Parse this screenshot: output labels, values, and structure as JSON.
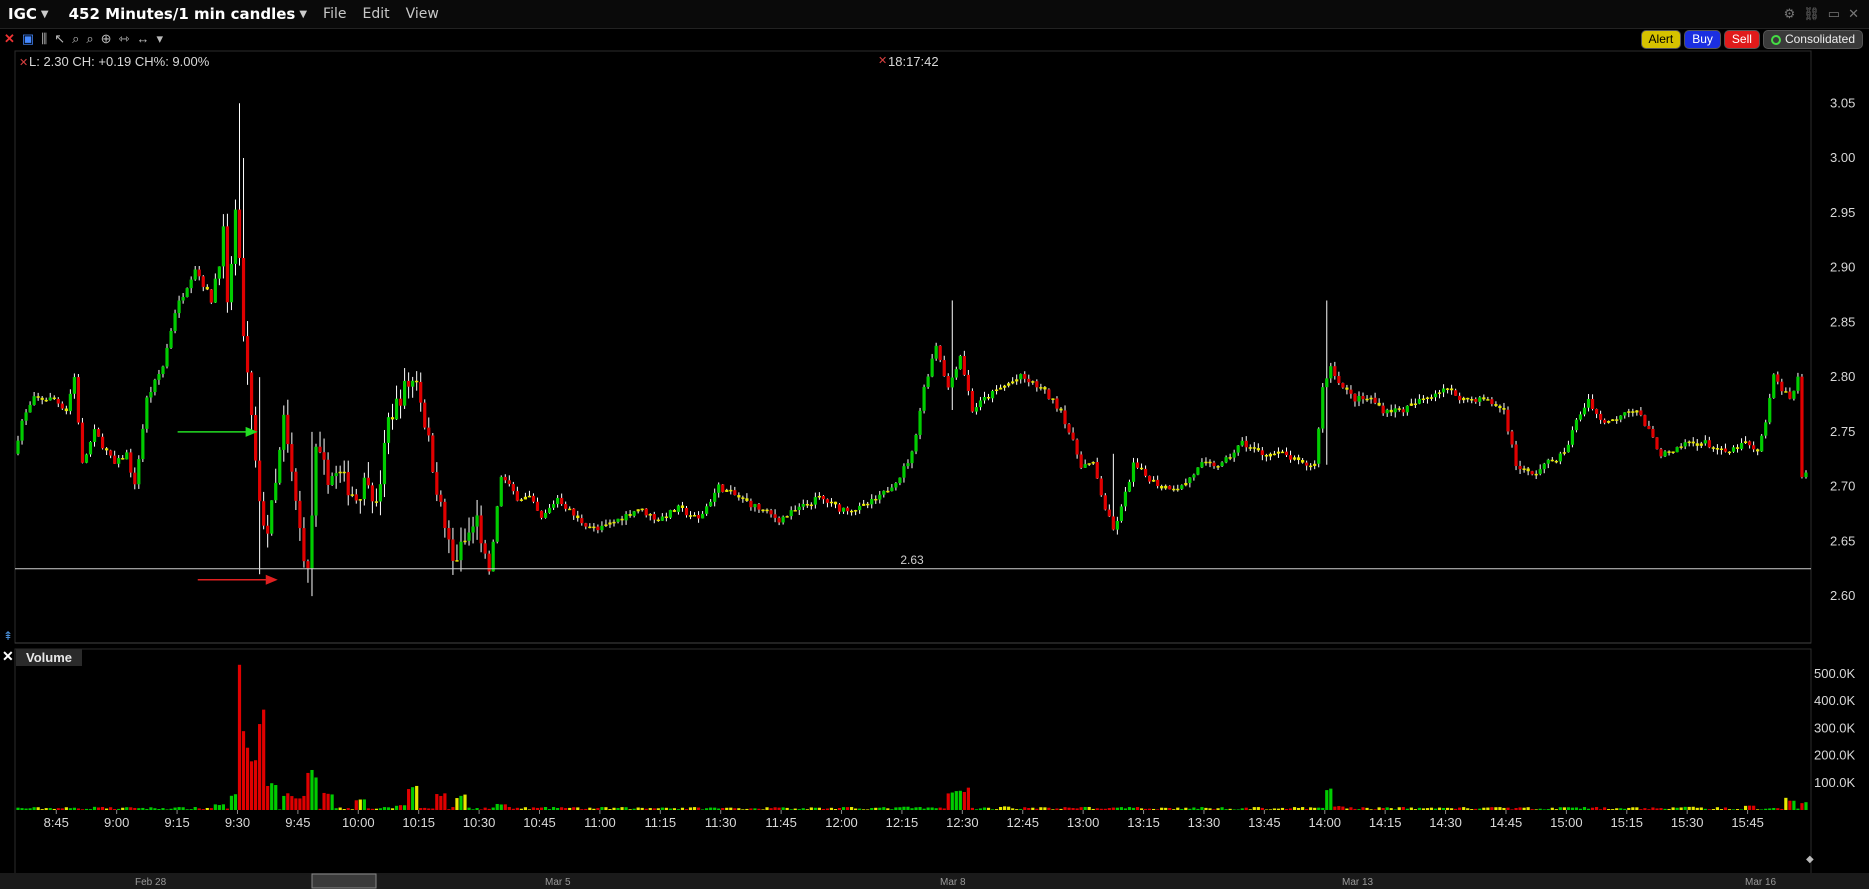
{
  "window": {
    "symbol": "IGC",
    "timeframe": "452 Minutes/1 min candles",
    "menus": [
      "File",
      "Edit",
      "View"
    ]
  },
  "toolbar": {
    "buttons": {
      "alert": "Alert",
      "buy": "Buy",
      "sell": "Sell",
      "consolidated": "Consolidated"
    }
  },
  "info": {
    "quote": "L: 2.30 CH: +0.19 CH%: 9.00%",
    "clock": "18:17:42",
    "line_label": "2.63"
  },
  "volume_panel": {
    "title": "Volume"
  },
  "colors": {
    "up": "#00cc00",
    "down": "#e00000",
    "neutral": "#e8e800",
    "wick": "#ffffff"
  },
  "chart_data": {
    "type": "candlestick",
    "price_axis": {
      "ticks": [
        "3.05",
        "3.00",
        "2.95",
        "2.90",
        "2.85",
        "2.80",
        "2.75",
        "2.70",
        "2.65",
        "2.60"
      ],
      "range": [
        2.56,
        3.095
      ]
    },
    "volume_axis": {
      "ticks": [
        "500.0K",
        "400.0K",
        "300.0K",
        "200.0K",
        "100.0K"
      ],
      "range": [
        0,
        580000
      ]
    },
    "time_ticks": [
      "8:45",
      "9:00",
      "9:15",
      "9:30",
      "9:45",
      "10:00",
      "10:15",
      "10:30",
      "10:45",
      "11:00",
      "11:15",
      "11:30",
      "11:45",
      "12:00",
      "12:15",
      "12:30",
      "12:45",
      "13:00",
      "13:15",
      "13:30",
      "13:45",
      "14:00",
      "14:15",
      "14:30",
      "14:45",
      "15:00",
      "15:15",
      "15:30",
      "15:45"
    ],
    "date_ticks": [
      "Feb 28",
      "Mar 5",
      "Mar 8",
      "Mar 13",
      "Mar 16"
    ],
    "horizontal_line": 2.625,
    "arrows": [
      {
        "color": "green",
        "price": 2.75,
        "time": "9:35"
      },
      {
        "color": "red",
        "price": 2.615,
        "time": "9:40"
      }
    ],
    "price_path": [
      [
        "8:35",
        2.73
      ],
      [
        "8:37",
        2.76
      ],
      [
        "8:40",
        2.78
      ],
      [
        "8:45",
        2.78
      ],
      [
        "8:48",
        2.77
      ],
      [
        "8:50",
        2.8
      ],
      [
        "8:52",
        2.72
      ],
      [
        "8:55",
        2.75
      ],
      [
        "9:00",
        2.72
      ],
      [
        "9:03",
        2.73
      ],
      [
        "9:05",
        2.7
      ],
      [
        "9:08",
        2.78
      ],
      [
        "9:12",
        2.81
      ],
      [
        "9:15",
        2.86
      ],
      [
        "9:20",
        2.9
      ],
      [
        "9:24",
        2.87
      ],
      [
        "9:27",
        2.93
      ],
      [
        "9:28",
        2.86
      ],
      [
        "9:30",
        2.95
      ],
      [
        "9:31",
        2.9
      ],
      [
        "9:32",
        2.84
      ],
      [
        "9:34",
        2.76
      ],
      [
        "9:36",
        2.68
      ],
      [
        "9:38",
        2.66
      ],
      [
        "9:40",
        2.7
      ],
      [
        "9:42",
        2.76
      ],
      [
        "9:44",
        2.71
      ],
      [
        "9:46",
        2.66
      ],
      [
        "9:48",
        2.62
      ],
      [
        "9:50",
        2.73
      ],
      [
        "9:53",
        2.71
      ],
      [
        "9:56",
        2.71
      ],
      [
        "10:00",
        2.69
      ],
      [
        "10:03",
        2.71
      ],
      [
        "10:05",
        2.68
      ],
      [
        "10:08",
        2.76
      ],
      [
        "10:12",
        2.79
      ],
      [
        "10:15",
        2.8
      ],
      [
        "10:18",
        2.74
      ],
      [
        "10:21",
        2.68
      ],
      [
        "10:24",
        2.63
      ],
      [
        "10:27",
        2.65
      ],
      [
        "10:30",
        2.67
      ],
      [
        "10:33",
        2.62
      ],
      [
        "10:36",
        2.71
      ],
      [
        "10:40",
        2.69
      ],
      [
        "10:43",
        2.69
      ],
      [
        "10:46",
        2.67
      ],
      [
        "10:50",
        2.69
      ],
      [
        "10:55",
        2.67
      ],
      [
        "11:00",
        2.66
      ],
      [
        "11:05",
        2.67
      ],
      [
        "11:10",
        2.68
      ],
      [
        "11:15",
        2.67
      ],
      [
        "11:20",
        2.68
      ],
      [
        "11:25",
        2.67
      ],
      [
        "11:30",
        2.7
      ],
      [
        "11:35",
        2.69
      ],
      [
        "11:40",
        2.68
      ],
      [
        "11:45",
        2.67
      ],
      [
        "11:50",
        2.68
      ],
      [
        "11:55",
        2.69
      ],
      [
        "12:00",
        2.68
      ],
      [
        "12:05",
        2.68
      ],
      [
        "12:10",
        2.69
      ],
      [
        "12:15",
        2.71
      ],
      [
        "12:18",
        2.73
      ],
      [
        "12:21",
        2.79
      ],
      [
        "12:24",
        2.83
      ],
      [
        "12:27",
        2.79
      ],
      [
        "12:30",
        2.82
      ],
      [
        "12:33",
        2.77
      ],
      [
        "12:36",
        2.78
      ],
      [
        "12:40",
        2.79
      ],
      [
        "12:45",
        2.8
      ],
      [
        "12:50",
        2.79
      ],
      [
        "12:55",
        2.77
      ],
      [
        "12:58",
        2.74
      ],
      [
        "13:00",
        2.72
      ],
      [
        "13:03",
        2.72
      ],
      [
        "13:06",
        2.68
      ],
      [
        "13:08",
        2.66
      ],
      [
        "13:10",
        2.68
      ],
      [
        "13:13",
        2.72
      ],
      [
        "13:16",
        2.71
      ],
      [
        "13:20",
        2.7
      ],
      [
        "13:25",
        2.7
      ],
      [
        "13:30",
        2.72
      ],
      [
        "13:35",
        2.72
      ],
      [
        "13:40",
        2.74
      ],
      [
        "13:45",
        2.73
      ],
      [
        "13:50",
        2.73
      ],
      [
        "13:55",
        2.72
      ],
      [
        "13:58",
        2.72
      ],
      [
        "14:00",
        2.79
      ],
      [
        "14:02",
        2.81
      ],
      [
        "14:05",
        2.79
      ],
      [
        "14:08",
        2.78
      ],
      [
        "14:12",
        2.78
      ],
      [
        "14:15",
        2.77
      ],
      [
        "14:20",
        2.77
      ],
      [
        "14:25",
        2.78
      ],
      [
        "14:30",
        2.79
      ],
      [
        "14:35",
        2.78
      ],
      [
        "14:40",
        2.78
      ],
      [
        "14:45",
        2.77
      ],
      [
        "14:48",
        2.72
      ],
      [
        "14:52",
        2.71
      ],
      [
        "14:55",
        2.72
      ],
      [
        "15:00",
        2.73
      ],
      [
        "15:03",
        2.76
      ],
      [
        "15:06",
        2.78
      ],
      [
        "15:09",
        2.76
      ],
      [
        "15:12",
        2.76
      ],
      [
        "15:15",
        2.77
      ],
      [
        "15:18",
        2.77
      ],
      [
        "15:21",
        2.75
      ],
      [
        "15:24",
        2.73
      ],
      [
        "15:27",
        2.73
      ],
      [
        "15:30",
        2.74
      ],
      [
        "15:35",
        2.74
      ],
      [
        "15:40",
        2.73
      ],
      [
        "15:45",
        2.74
      ],
      [
        "15:48",
        2.73
      ],
      [
        "15:50",
        2.76
      ],
      [
        "15:52",
        2.8
      ],
      [
        "15:54",
        2.79
      ],
      [
        "15:56",
        2.78
      ],
      [
        "15:58",
        2.8
      ],
      [
        "15:59",
        2.71
      ]
    ],
    "volume_profile": [
      [
        "8:35",
        3000
      ],
      [
        "8:45",
        4000
      ],
      [
        "8:55",
        12000
      ],
      [
        "9:05",
        8000
      ],
      [
        "9:15",
        9000
      ],
      [
        "9:25",
        25000
      ],
      [
        "9:29",
        60000
      ],
      [
        "9:30",
        540000
      ],
      [
        "9:31",
        300000
      ],
      [
        "9:33",
        190000
      ],
      [
        "9:35",
        380000
      ],
      [
        "9:38",
        120000
      ],
      [
        "9:42",
        70000
      ],
      [
        "9:45",
        55000
      ],
      [
        "9:48",
        160000
      ],
      [
        "9:52",
        80000
      ],
      [
        "10:00",
        40000
      ],
      [
        "10:10",
        20000
      ],
      [
        "10:13",
        90000
      ],
      [
        "10:20",
        70000
      ],
      [
        "10:25",
        60000
      ],
      [
        "10:35",
        25000
      ],
      [
        "10:50",
        10000
      ],
      [
        "11:15",
        9000
      ],
      [
        "11:45",
        10000
      ],
      [
        "12:15",
        12000
      ],
      [
        "12:27",
        70000
      ],
      [
        "12:30",
        85000
      ],
      [
        "12:40",
        15000
      ],
      [
        "13:00",
        12000
      ],
      [
        "13:30",
        8000
      ],
      [
        "13:58",
        10000
      ],
      [
        "14:00",
        80000
      ],
      [
        "14:03",
        15000
      ],
      [
        "14:30",
        9000
      ],
      [
        "15:00",
        12000
      ],
      [
        "15:30",
        12000
      ],
      [
        "15:45",
        18000
      ],
      [
        "15:55",
        45000
      ],
      [
        "15:59",
        30000
      ]
    ]
  }
}
